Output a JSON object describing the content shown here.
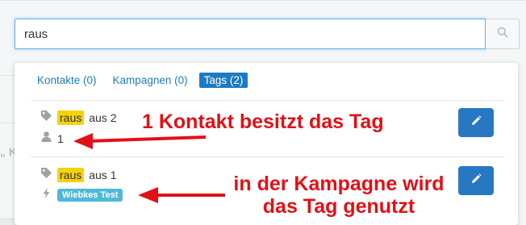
{
  "search": {
    "value": "raus",
    "placeholder": ""
  },
  "tabs": [
    {
      "label": "Kontakte (0)",
      "active": false
    },
    {
      "label": "Kampagnen (0)",
      "active": false
    },
    {
      "label": "Tags (2)",
      "active": true
    }
  ],
  "results": [
    {
      "tag": "raus",
      "suffix": "aus 2",
      "contact_count": "1"
    },
    {
      "tag": "raus",
      "suffix": "aus 1",
      "campaign": "Wiebkes Test"
    }
  ],
  "annotations": {
    "first": "1 Kontakt besitzt das Tag",
    "second_line1": "in der Kampagne wird",
    "second_line2": "das Tag genutzt"
  },
  "background": {
    "fragment": "„ K"
  },
  "colors": {
    "accent": "#1f7bc1",
    "tag_highlight": "#f5d20f",
    "badge": "#4fb9d9",
    "edit_button": "#2877c2",
    "annotation": "#e21016"
  },
  "icons": [
    "search-icon",
    "tag-icon",
    "user-icon",
    "bolt-icon",
    "pencil-icon"
  ]
}
